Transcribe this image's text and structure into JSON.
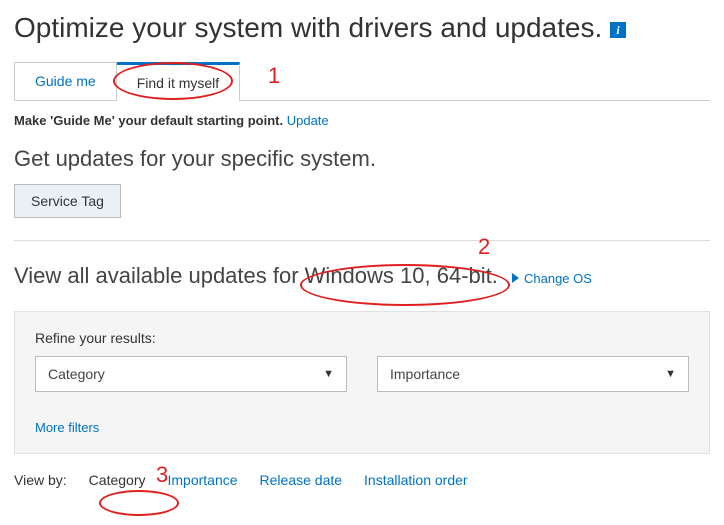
{
  "page_title": "Optimize your system with drivers and updates.",
  "tabs": {
    "guide_me": "Guide me",
    "find_it_myself": "Find it myself"
  },
  "default_note": {
    "prefix": "Make 'Guide Me' your default starting point. ",
    "link": "Update"
  },
  "get_updates_heading": "Get updates for your specific system.",
  "service_tag_button": "Service Tag",
  "updates_heading": {
    "prefix": "View all available updates for ",
    "os": "Windows 10, 64-bit."
  },
  "change_os_link": "Change OS",
  "refine": {
    "label": "Refine your results:",
    "category_select": "Category",
    "importance_select": "Importance",
    "more_filters": "More filters"
  },
  "view_by": {
    "label": "View by:",
    "options": {
      "category": "Category",
      "importance": "Importance",
      "release_date": "Release date",
      "installation_order": "Installation order"
    }
  },
  "annotations": {
    "one": "1",
    "two": "2",
    "three": "3"
  }
}
